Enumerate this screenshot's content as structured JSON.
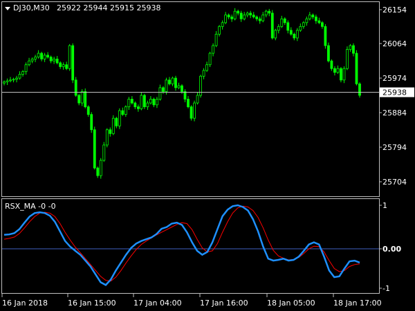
{
  "main_chart": {
    "symbol_label": "DJ30,M30",
    "ohlc_text": "25922 25944 25915 25938",
    "price_ticks": [
      "26154",
      "26064",
      "25974",
      "25884",
      "25794",
      "25704"
    ],
    "price_tick_values": [
      26154,
      26064,
      25974,
      25884,
      25794,
      25704
    ],
    "current_price_label": "25938",
    "current_price": 25938,
    "candle_color": "#00ff00",
    "current_line_color": "#c0c0c0"
  },
  "indicator": {
    "title": "RSX_MA -0 -0",
    "ticks": [
      "1",
      "0.00",
      "-1"
    ],
    "tick_values": [
      1,
      0,
      -1
    ],
    "rsx_color": "#1e90ff",
    "ma_color": "#ff0000",
    "zero_line_color": "#4060c0"
  },
  "time_axis": {
    "labels": [
      "16 Jan 2018",
      "16 Jan 15:00",
      "17 Jan 04:00",
      "17 Jan 16:00",
      "18 Jan 05:00",
      "18 Jan 17:00"
    ]
  },
  "chart_data": [
    {
      "type": "candlestick",
      "y_range": [
        25680,
        26180
      ],
      "closes": [
        25965,
        25968,
        25970,
        25972,
        25975,
        25985,
        25992,
        26010,
        26020,
        26025,
        26030,
        26040,
        26025,
        26035,
        26030,
        26020,
        26025,
        26015,
        26005,
        26010,
        26000,
        26060,
        25970,
        25930,
        25910,
        25940,
        25900,
        25880,
        25840,
        25740,
        25720,
        25760,
        25800,
        25840,
        25830,
        25870,
        25850,
        25890,
        25880,
        25900,
        25920,
        25910,
        25900,
        25895,
        25930,
        25900,
        25910,
        25920,
        25905,
        25920,
        25950,
        25940,
        25970,
        25960,
        25975,
        25950,
        25955,
        25940,
        25920,
        25900,
        25870,
        25910,
        25930,
        25980,
        25995,
        26010,
        26040,
        26060,
        26090,
        26110,
        26120,
        26140,
        26135,
        26130,
        26150,
        26145,
        26130,
        26140,
        26145,
        26140,
        26135,
        26130,
        26125,
        26140,
        26150,
        26145,
        26080,
        26100,
        26110,
        26130,
        26120,
        26100,
        26090,
        26080,
        26100,
        26110,
        26120,
        26130,
        26140,
        26135,
        26125,
        26120,
        26110,
        26060,
        26020,
        26000,
        25990,
        26000,
        25970,
        26000,
        26050,
        26060,
        26040,
        25960,
        25930
      ]
    },
    {
      "type": "line",
      "series": [
        {
          "values": [
            0.32,
            0.33,
            0.36,
            0.45,
            0.6,
            0.74,
            0.82,
            0.84,
            0.82,
            0.76,
            0.62,
            0.4,
            0.18,
            0.05,
            -0.05,
            -0.15,
            -0.3,
            -0.45,
            -0.65,
            -0.85,
            -0.92,
            -0.78,
            -0.55,
            -0.35,
            -0.15,
            0.02,
            0.12,
            0.18,
            0.22,
            0.26,
            0.34,
            0.46,
            0.5,
            0.58,
            0.6,
            0.55,
            0.38,
            0.15,
            -0.05,
            -0.15,
            -0.08,
            0.15,
            0.45,
            0.75,
            0.9,
            0.98,
            1.0,
            0.96,
            0.88,
            0.68,
            0.4,
            0.05,
            -0.25,
            -0.3,
            -0.28,
            -0.25,
            -0.3,
            -0.28,
            -0.2,
            -0.05,
            0.1,
            0.15,
            0.1,
            -0.2,
            -0.55,
            -0.72,
            -0.7,
            -0.5,
            -0.32,
            -0.3,
            -0.35
          ]
        },
        {
          "values": [
            0.22,
            0.24,
            0.27,
            0.35,
            0.48,
            0.62,
            0.74,
            0.82,
            0.84,
            0.82,
            0.74,
            0.58,
            0.38,
            0.2,
            0.04,
            -0.1,
            -0.25,
            -0.4,
            -0.55,
            -0.7,
            -0.8,
            -0.82,
            -0.72,
            -0.55,
            -0.36,
            -0.18,
            -0.02,
            0.1,
            0.18,
            0.25,
            0.32,
            0.38,
            0.44,
            0.5,
            0.56,
            0.6,
            0.58,
            0.44,
            0.22,
            0.02,
            -0.08,
            -0.05,
            0.12,
            0.38,
            0.62,
            0.82,
            0.94,
            0.98,
            0.96,
            0.88,
            0.72,
            0.48,
            0.2,
            -0.04,
            -0.18,
            -0.24,
            -0.28,
            -0.27,
            -0.22,
            -0.12,
            0.0,
            0.06,
            0.05,
            -0.08,
            -0.3,
            -0.5,
            -0.58,
            -0.55,
            -0.45,
            -0.4,
            -0.38
          ]
        }
      ],
      "y_range": [
        -1.1,
        1.1
      ]
    }
  ]
}
